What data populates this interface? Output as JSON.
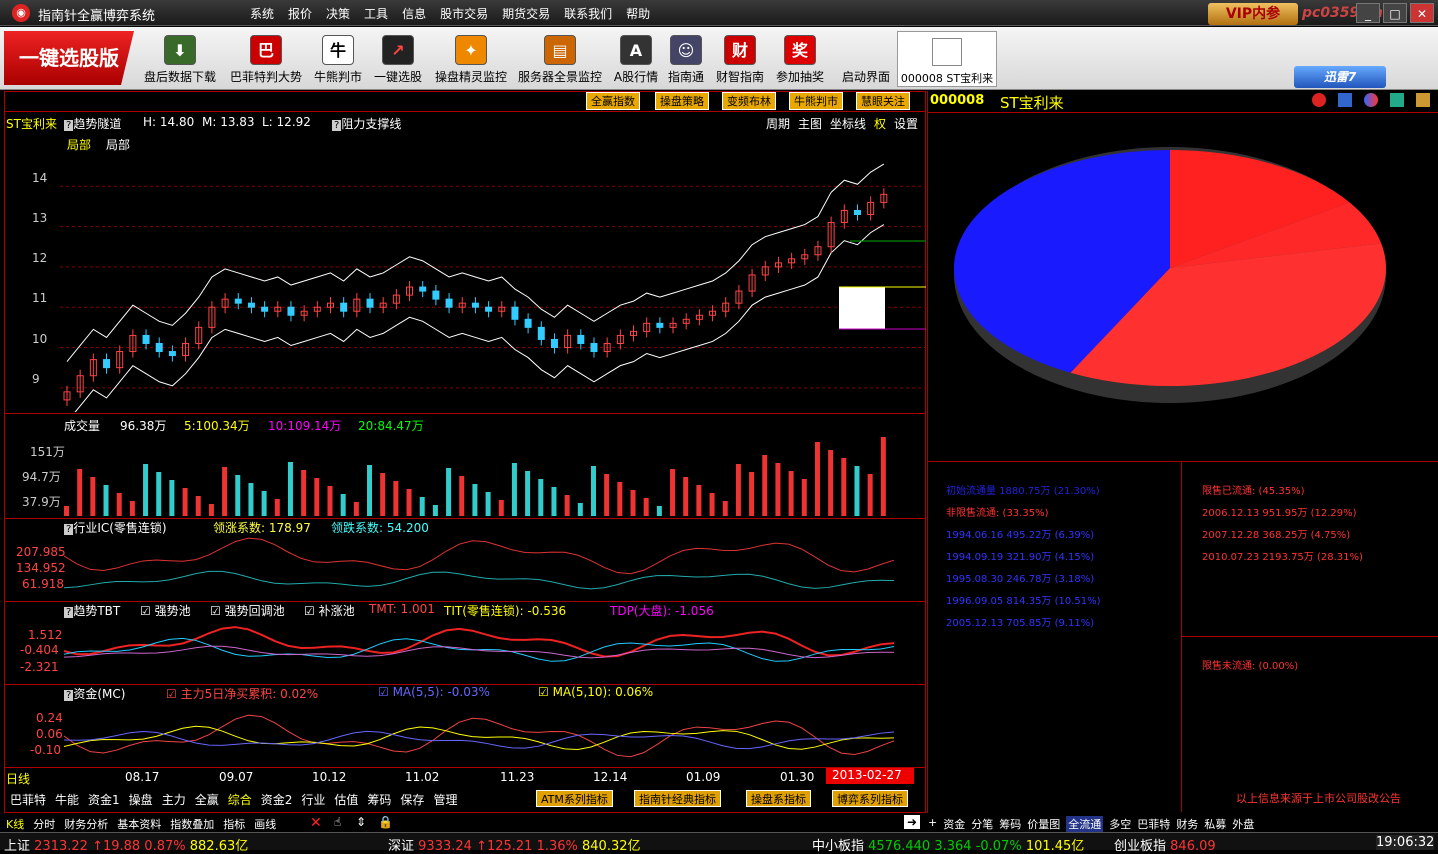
{
  "app": {
    "title": "指南针全赢博弈系统",
    "logo": "logo-icon",
    "menu": [
      "系统",
      "报价",
      "决策",
      "工具",
      "信息",
      "股市交易",
      "期货交易",
      "联系我们",
      "帮助"
    ],
    "vip": "VIP内参",
    "watermark": "pc0359.cn"
  },
  "toolbar": {
    "banner": "一键选股版",
    "tools": [
      {
        "label": "盘后数据下载",
        "icon": "download-icon"
      },
      {
        "label": "巴菲特判大势",
        "icon": "buffett-icon"
      },
      {
        "label": "牛熊判市",
        "icon": "bull-bear-icon"
      },
      {
        "label": "一键选股",
        "icon": "stock-pick-icon"
      },
      {
        "label": "操盘精灵监控",
        "icon": "spirit-icon"
      },
      {
        "label": "服务器全景监控",
        "icon": "server-icon"
      },
      {
        "label": "A股行情",
        "icon": "a-share-icon"
      },
      {
        "label": "指南通",
        "icon": "guide-icon"
      },
      {
        "label": "财智指南",
        "icon": "finance-icon"
      },
      {
        "label": "参加抽奖",
        "icon": "lottery-icon"
      },
      {
        "label": "启动界面",
        "icon": "launch-icon"
      }
    ],
    "stocktab": "000008 ST宝利来",
    "xunlei": "迅雷7"
  },
  "chart_header": {
    "buttons": [
      "全赢指数",
      "操盘策略",
      "变频布林",
      "牛熊判市",
      "慧眼关注"
    ],
    "stock": "ST宝利来",
    "indicator": "趋势隧道",
    "h": "H: 14.80",
    "m": "M: 13.83",
    "l": "L: 12.92",
    "support": "阻力支撑线",
    "local1": "局部",
    "local2": "局部",
    "controls": [
      "周期",
      "主图",
      "坐标线",
      "权",
      "设置"
    ]
  },
  "chart_data": [
    {
      "type": "candlestick",
      "title": "趋势隧道",
      "yticks": [
        14.0,
        13.0,
        12.0,
        11.0,
        10.0,
        9.0
      ],
      "ylim": [
        8.4,
        14.9
      ],
      "close": [
        8.9,
        9.3,
        9.7,
        9.5,
        9.9,
        10.3,
        10.1,
        9.9,
        9.8,
        10.1,
        10.5,
        11.0,
        11.2,
        11.1,
        11.0,
        10.9,
        11.0,
        10.8,
        10.9,
        11.0,
        11.1,
        10.9,
        11.2,
        11.0,
        11.1,
        11.3,
        11.5,
        11.4,
        11.2,
        11.0,
        11.1,
        11.0,
        10.9,
        11.0,
        10.7,
        10.5,
        10.2,
        10.0,
        10.3,
        10.1,
        9.9,
        10.1,
        10.3,
        10.4,
        10.6,
        10.5,
        10.6,
        10.7,
        10.8,
        10.9,
        11.1,
        11.4,
        11.8,
        12.0,
        12.1,
        12.2,
        12.3,
        12.5,
        13.1,
        13.4,
        13.3,
        13.6,
        13.8
      ]
    },
    {
      "type": "bar",
      "title": "成交量",
      "values_label": [
        "96.38万",
        "5:100.34万",
        "10:109.14万",
        "20:84.47万"
      ],
      "yticks": [
        "151万",
        "94.7万",
        "37.9万"
      ]
    },
    {
      "type": "line",
      "title": "行业IC(零售连锁)",
      "labels": [
        "领涨系数: 178.97",
        "领跌系数: 54.200"
      ],
      "yticks": [
        "207.985",
        "134.952",
        "61.918"
      ]
    },
    {
      "type": "line",
      "title": "趋势TBT",
      "labels": [
        "强势池",
        "强势回调池",
        "补涨池",
        "TMT: 1.001",
        "TIT(零售连锁): -0.536",
        "TDP(大盘): -1.056"
      ],
      "yticks": [
        "1.512",
        "-0.404",
        "-2.321"
      ]
    },
    {
      "type": "line",
      "title": "资金(MC)",
      "labels": [
        "主力5日净买累积: 0.02%",
        "MA(5,5): -0.03%",
        "MA(5,10): 0.06%"
      ],
      "yticks": [
        "0.24",
        "0.06",
        "-0.10"
      ]
    },
    {
      "type": "pie",
      "title": "ST宝利来",
      "values": [
        12.29,
        4.75,
        28.31,
        33.35
      ],
      "colors": [
        "#ff2020",
        "#ff2828",
        "#ff3030",
        "#1a1aff"
      ]
    }
  ],
  "xaxis": {
    "label": "日线",
    "dates": [
      "08.17",
      "09.07",
      "10.12",
      "11.02",
      "11.23",
      "12.14",
      "01.09",
      "01.30"
    ],
    "current": "2013-02-27"
  },
  "tabs": {
    "left": [
      "巴菲特",
      "牛能",
      "资金1",
      "操盘",
      "主力",
      "全赢",
      "综合",
      "资金2",
      "行业",
      "估值",
      "筹码",
      "保存",
      "管理"
    ],
    "tags": [
      "ATM系列指标",
      "指南针经典指标",
      "操盘系指标",
      "博弈系列指标"
    ]
  },
  "bottomtabs": [
    "K线",
    "分时",
    "财务分析",
    "基本资料",
    "指数叠加",
    "指标",
    "画线"
  ],
  "righttabs": [
    "资金",
    "分笔",
    "筹码",
    "价量图",
    "全流通",
    "多空",
    "巴菲特",
    "财务",
    "私募",
    "外盘"
  ],
  "right": {
    "code": "000008",
    "name": "ST宝利来",
    "left": [
      "初始流通量 1880.75万 (21.30%)",
      "非限售流通: (33.35%)",
      "1994.06.16 495.22万 (6.39%)",
      "1994.09.19 321.90万 (4.15%)",
      "1995.08.30 246.78万 (3.18%)",
      "1996.09.05 814.35万 (10.51%)",
      "2005.12.13 705.85万 (9.11%)"
    ],
    "lim_done": [
      "限售已流通: (45.35%)",
      "2006.12.13 951.95万 (12.29%)",
      "2007.12.28 368.25万 (4.75%)",
      "2010.07.23 2193.75万 (28.31%)"
    ],
    "lim_not": "限售未流通: (0.00%)",
    "source": "以上信息来源于上市公司股改公告"
  },
  "ticker": [
    {
      "name": "上证",
      "val": "2313.22",
      "chg": "↑19.88 0.87%",
      "vol": "882.63亿"
    },
    {
      "name": "深证",
      "val": "9333.24",
      "chg": "↑125.21 1.36%",
      "vol": "840.32亿"
    },
    {
      "name": "中小板指",
      "val": "4576.440",
      "chg": "3.364 -0.07%",
      "vol": "101.45亿"
    },
    {
      "name": "创业板指",
      "val": "846.09"
    }
  ],
  "clock": "19:06:32"
}
